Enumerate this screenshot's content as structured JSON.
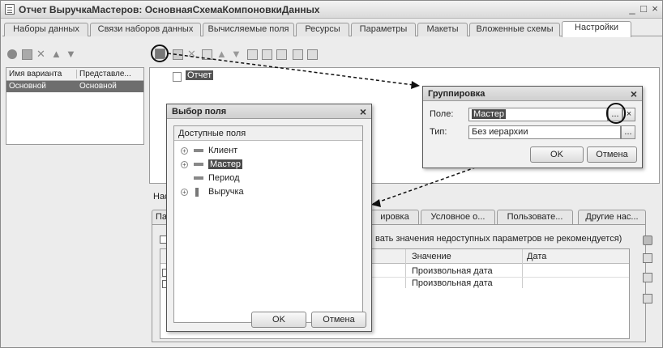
{
  "window": {
    "title": "Отчет ВыручкаМастеров: ОсновнаяСхемаКомпоновкиДанных",
    "min": "_",
    "max": "□",
    "close": "×"
  },
  "tabs": [
    "Наборы данных",
    "Связи наборов данных",
    "Вычисляемые поля",
    "Ресурсы",
    "Параметры",
    "Макеты",
    "Вложенные схемы",
    "Настройки"
  ],
  "variants": {
    "col1": "Имя варианта",
    "col2": "Представле...",
    "row_name": "Основной",
    "row_repr": "Основной"
  },
  "tree": {
    "node": "Отчет"
  },
  "settings_label": "Наст",
  "panel": {
    "tabs": [
      "Па",
      "ировка",
      "Условное о...",
      "Пользовате...",
      "Другие нас..."
    ],
    "note": "вать значения недоступных параметров не рекомендуется)",
    "columns": [
      "Значение",
      "Дата"
    ],
    "rows": [
      {
        "value": "Произвольная дата"
      },
      {
        "value": "Произвольная дата"
      }
    ]
  },
  "field_dialog": {
    "title": "Выбор поля",
    "header": "Доступные поля",
    "items": [
      "Клиент",
      "Мастер",
      "Период",
      "Выручка"
    ],
    "ok": "OK",
    "cancel": "Отмена"
  },
  "group_dialog": {
    "title": "Группировка",
    "field_label": "Поле:",
    "field_value": "Мастер",
    "type_label": "Тип:",
    "type_value": "Без иерархии",
    "ok": "OK",
    "cancel": "Отмена",
    "ellipsis": "...",
    "clear": "×"
  },
  "colors": {
    "highlight": "#4a4a4a",
    "frame": "#9a9a9a"
  }
}
